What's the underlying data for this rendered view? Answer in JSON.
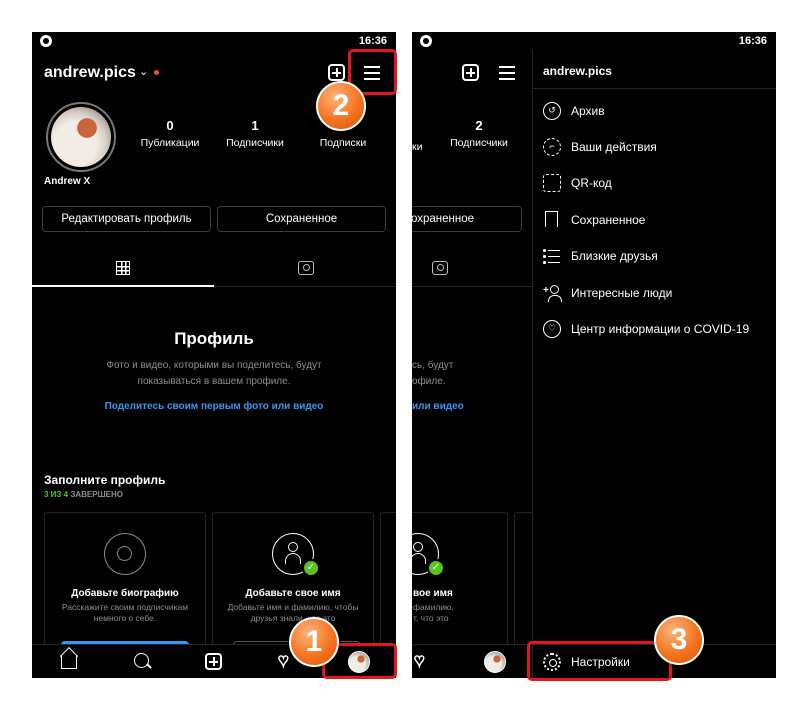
{
  "status": {
    "time": "16:36"
  },
  "profile": {
    "username": "andrew.pics",
    "display_name": "Andrew X",
    "stats": [
      {
        "value": "0",
        "label": "Публикации"
      },
      {
        "value": "1",
        "label": "Подписчики"
      },
      {
        "value": "",
        "label": "Подписки"
      }
    ],
    "right_stat": {
      "value": "2",
      "label_partial": "Подписчики",
      "left_partial": "ки"
    },
    "edit_button": "Редактировать профиль",
    "saved_button": "Сохраненное",
    "saved_button_partial": "охраненное"
  },
  "empty": {
    "title": "Профиль",
    "description": "Фото и видео, которыми вы поделитесь, будут показываться в вашем профиле.",
    "description_partial": "сь, будут\nофиле.",
    "link": "Поделитесь своим первым фото или видео",
    "link_partial": "или видео"
  },
  "complete": {
    "title": "Заполните профиль",
    "progress_green": "3 ИЗ 4",
    "progress_rest": " ЗАВЕРШЕНО",
    "cards": [
      {
        "title": "Добавьте биографию",
        "desc": "Расскажите своим подписчикам немного о себе."
      },
      {
        "title": "Добавьте свое имя",
        "desc": "Добавьте имя и фамилию, чтобы друзья знали, что это"
      }
    ],
    "card_partial": {
      "title": "вое имя",
      "desc": "фамилию,\nт, что это"
    }
  },
  "drawer": {
    "title": "andrew.pics",
    "items": [
      {
        "label": "Архив",
        "icon": "archive-icon"
      },
      {
        "label": "Ваши действия",
        "icon": "activity-icon"
      },
      {
        "label": "QR-код",
        "icon": "qr-code-icon"
      },
      {
        "label": "Сохраненное",
        "icon": "bookmark-icon"
      },
      {
        "label": "Близкие друзья",
        "icon": "close-friends-icon"
      },
      {
        "label": "Интересные люди",
        "icon": "add-user-icon"
      },
      {
        "label": "Центр информации о COVID-19",
        "icon": "covid-info-icon"
      }
    ],
    "settings": "Настройки"
  },
  "annotations": {
    "one": "1",
    "two": "2",
    "three": "3"
  },
  "colors": {
    "highlight": "#e5161b",
    "badge": "#f4731f",
    "link": "#3897f0",
    "success": "#58c322",
    "notification": "#ed4956"
  }
}
